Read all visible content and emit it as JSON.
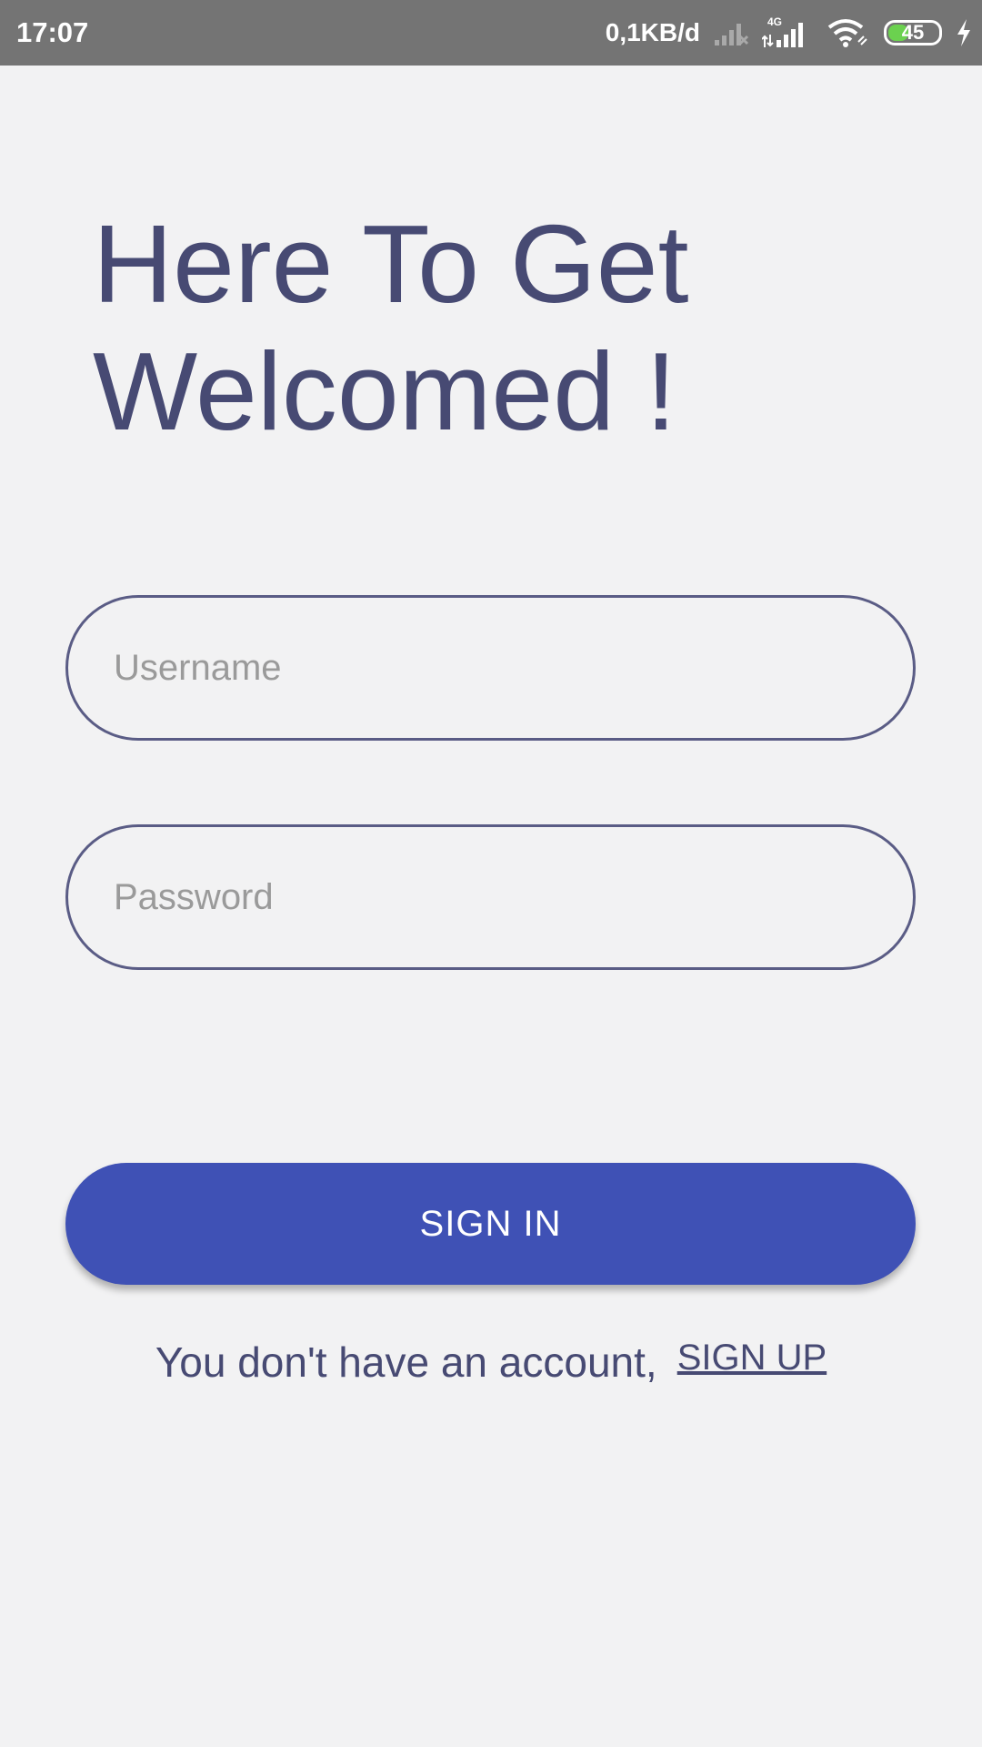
{
  "status_bar": {
    "time": "17:07",
    "net_speed": "0,1KB/d",
    "network_type": "4G",
    "battery_level": "45",
    "battery_fraction": 0.45,
    "icons": [
      "signal-no-sim-icon",
      "signal-4g-icon",
      "wifi-icon",
      "battery-icon",
      "charging-icon"
    ],
    "colors": {
      "bar_bg": "#747474",
      "battery_fill": "#6bd14f"
    }
  },
  "main": {
    "title_line1": "Here To Get",
    "title_line2": "Welcomed !",
    "username_placeholder": "Username",
    "password_placeholder": "Password",
    "signin_label": "SIGN IN",
    "signup_prompt": "You don't have an account,",
    "signup_label": "SIGN UP"
  },
  "colors": {
    "background": "#f2f2f3",
    "title": "#474a73",
    "field_border": "#5a5c85",
    "primary_button": "#3f51b5",
    "placeholder": "#9a9a9a"
  }
}
